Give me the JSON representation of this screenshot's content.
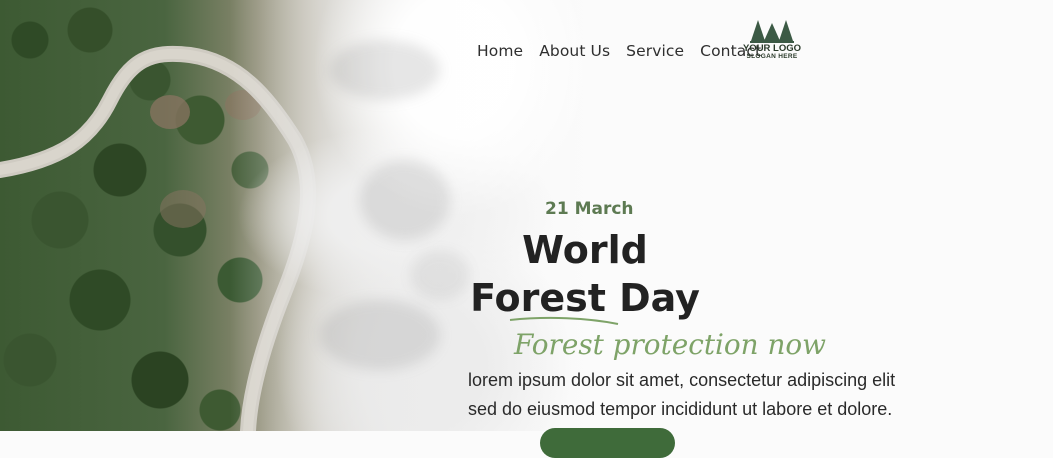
{
  "nav": {
    "items": [
      {
        "label": "Home"
      },
      {
        "label": "About Us"
      },
      {
        "label": "Service"
      },
      {
        "label": "Contact"
      }
    ]
  },
  "logo": {
    "name": "YOUR LOGO",
    "slogan": "SLOGAN HERE",
    "icon": "pine-trees-icon",
    "color": "#3c5a45"
  },
  "hero": {
    "date": "21 March",
    "title_line1": "World",
    "title_line2": "Forest Day",
    "script_text": "Forest protection now",
    "description_line1": "lorem ipsum dolor sit amet, consectetur adipiscing elit",
    "description_line2": "sed do eiusmod tempor incididunt ut labore et dolore.",
    "accent_color": "#7ea368",
    "date_color": "#5d7a52"
  }
}
